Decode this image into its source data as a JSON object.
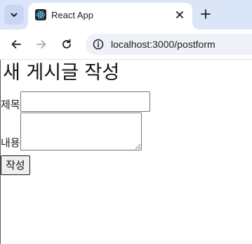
{
  "browser": {
    "tab": {
      "title": "React App",
      "favicon": "react-logo-icon",
      "close_icon": "close-icon"
    },
    "tab_search_icon": "chevron-down-icon",
    "new_tab_icon": "plus-icon",
    "nav": {
      "back_icon": "arrow-left-icon",
      "forward_icon": "arrow-right-icon",
      "reload_icon": "reload-icon"
    },
    "omnibox": {
      "site_info_icon": "info-icon",
      "url": "localhost:3000/postform"
    },
    "colors": {
      "tab_strip": "#dbe5f8",
      "omnibox": "#eef1f7",
      "react_logo": "#61dafb"
    }
  },
  "page": {
    "heading": "새 게시글 작성",
    "form": {
      "title_label": "제목",
      "title_value": "",
      "content_label": "내용",
      "content_value": "",
      "submit_label": "작성"
    }
  }
}
